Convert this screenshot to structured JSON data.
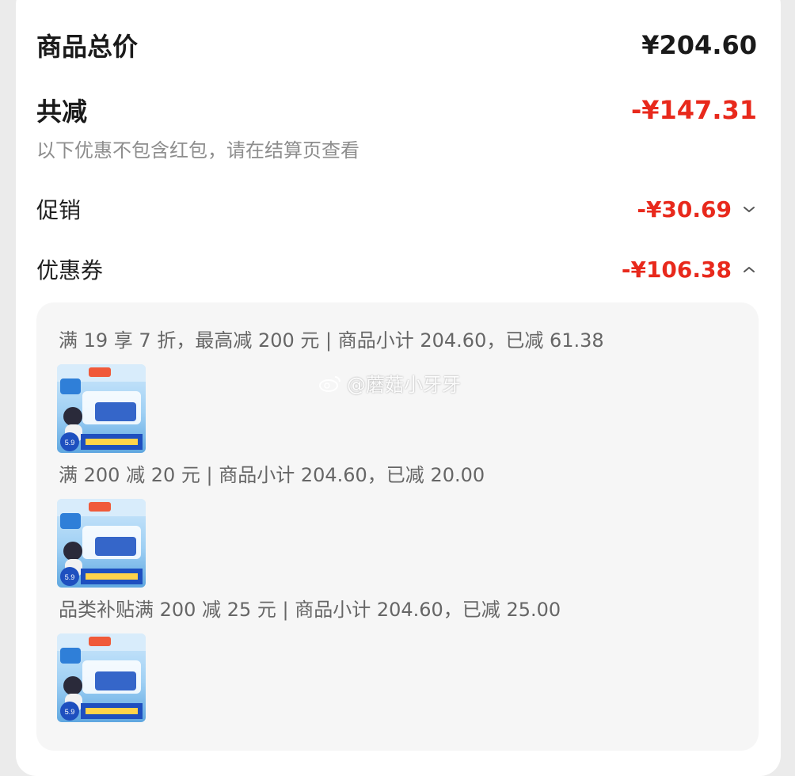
{
  "summary": {
    "total_label": "商品总价",
    "total_value": "¥204.60",
    "reduce_label": "共减",
    "reduce_value": "-¥147.31",
    "hint": "以下优惠不包含红包，请在结算页查看"
  },
  "discounts": [
    {
      "label": "促销",
      "value": "-¥30.69",
      "chevron": "chevron-down"
    },
    {
      "label": "优惠券",
      "value": "-¥106.38",
      "chevron": "chevron-up"
    }
  ],
  "coupons": [
    {
      "text": "满 19 享 7 折，最高减 200 元 | 商品小计 204.60，已减 61.38",
      "product_badge": "5.9"
    },
    {
      "text": "满 200 减 20 元 | 商品小计 204.60，已减 20.00",
      "product_badge": "5.9"
    },
    {
      "text": "品类补贴满 200 减 25 元 | 商品小计 204.60，已减 25.00",
      "product_badge": "5.9"
    }
  ],
  "watermark": "@蘑菇小牙牙",
  "colors": {
    "discount_red": "#e8291c",
    "panel_bg": "#f6f6f6",
    "card_bg": "#ffffff"
  }
}
